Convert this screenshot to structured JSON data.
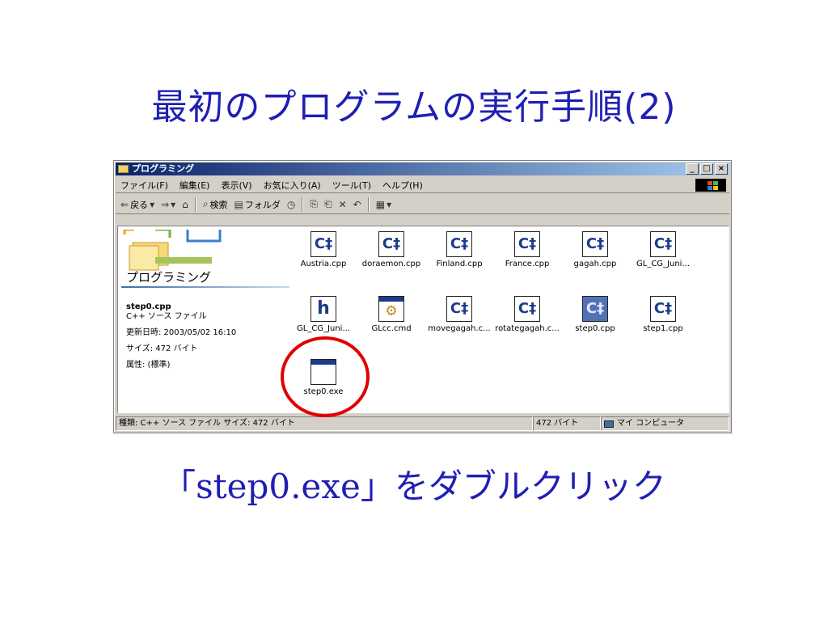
{
  "slide": {
    "title": "最初のプログラムの実行手順(2)",
    "caption": "「step0.exe」をダブルクリック"
  },
  "window": {
    "title": "プログラミング",
    "buttons": {
      "minimize": "_",
      "maximize": "□",
      "close": "×"
    },
    "menu": [
      "ファイル(F)",
      "編集(E)",
      "表示(V)",
      "お気に入り(A)",
      "ツール(T)",
      "ヘルプ(H)"
    ],
    "toolbar": {
      "back": "戻る",
      "search": "検索",
      "folders": "フォルダ"
    },
    "left_pane": {
      "folder_title": "プログラミング",
      "file_name": "step0.cpp",
      "file_type": "C++ ソース ファイル",
      "modified": "更新日時: 2003/05/02 16:10",
      "size": "サイズ: 472 バイト",
      "attributes": "属性: (標準)"
    },
    "files": [
      {
        "name": "Austria.cpp",
        "icon": "cpp-file-icon"
      },
      {
        "name": "doraemon.cpp",
        "icon": "cpp-file-icon"
      },
      {
        "name": "Finland.cpp",
        "icon": "cpp-file-icon"
      },
      {
        "name": "France.cpp",
        "icon": "cpp-file-icon"
      },
      {
        "name": "gagah.cpp",
        "icon": "cpp-file-icon"
      },
      {
        "name": "GL_CG_Juni...",
        "icon": "cpp-file-icon"
      },
      {
        "name": "GL_CG_Juni...",
        "icon": "header-file-icon"
      },
      {
        "name": "GLcc.cmd",
        "icon": "cmd-file-icon"
      },
      {
        "name": "movegagah.c...",
        "icon": "cpp-file-icon"
      },
      {
        "name": "rotategagah.c...",
        "icon": "cpp-file-icon"
      },
      {
        "name": "step0.cpp",
        "icon": "cpp-file-icon",
        "selected": true
      },
      {
        "name": "step1.cpp",
        "icon": "cpp-file-icon"
      },
      {
        "name": "step0.exe",
        "icon": "exe-file-icon"
      }
    ],
    "status": {
      "info": "種類: C++ ソース ファイル サイズ: 472 バイト",
      "size": "472 バイト",
      "location": "マイ コンピュータ"
    }
  },
  "colors": {
    "title_text": "#1f1fb4",
    "highlight": "#e00000",
    "titlebar": "#0a246a"
  }
}
